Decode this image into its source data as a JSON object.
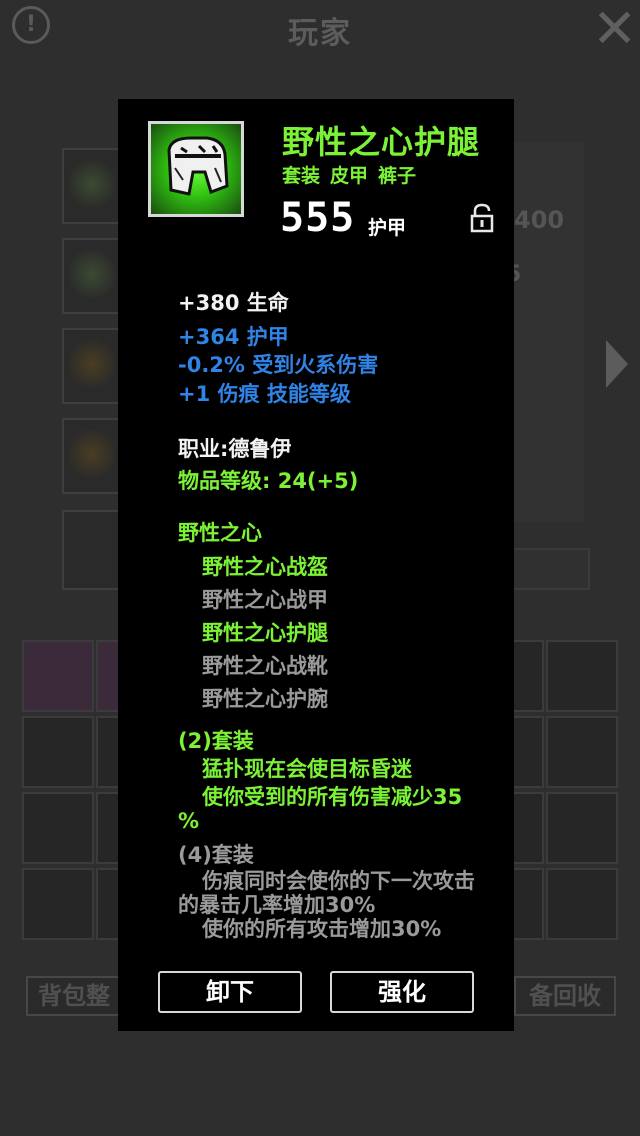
{
  "background": {
    "title": "玩家",
    "stat_partial": "400",
    "stat_partial2": "5",
    "sort_button": "背包整",
    "recycle_button": "备回收"
  },
  "item": {
    "name": "野性之心护腿",
    "tags": [
      "套装",
      "皮甲",
      "裤子"
    ],
    "armor_value": "555",
    "armor_unit": "护甲",
    "icon": "pants-armor-icon",
    "locked": false
  },
  "stats": {
    "base": "+380 生命",
    "affixes": [
      "+364 护甲",
      "-0.2% 受到火系伤害",
      "+1 伤痕 技能等级"
    ]
  },
  "requirements": {
    "class": "职业:德鲁伊",
    "item_level": "物品等级: 24(+5)"
  },
  "set": {
    "name": "野性之心",
    "pieces": [
      {
        "name": "野性之心战盔",
        "owned": true
      },
      {
        "name": "野性之心战甲",
        "owned": false
      },
      {
        "name": "野性之心护腿",
        "owned": true
      },
      {
        "name": "野性之心战靴",
        "owned": false
      },
      {
        "name": "野性之心护腕",
        "owned": false
      }
    ],
    "bonus2": {
      "label": "(2)套装",
      "effects": [
        "猛扑现在会使目标昏迷",
        "使你受到的所有伤害减少35",
        "%"
      ]
    },
    "bonus4": {
      "label": "(4)套装",
      "effects": [
        "伤痕同时会使你的下一次攻击",
        "的暴击几率增加30%",
        "使你的所有攻击增加30%"
      ]
    }
  },
  "buttons": {
    "unequip": "卸下",
    "upgrade": "强化"
  },
  "colors": {
    "set_active": "#7cf236",
    "affix_blue": "#2f84e6",
    "inactive": "#9a9a9a"
  }
}
